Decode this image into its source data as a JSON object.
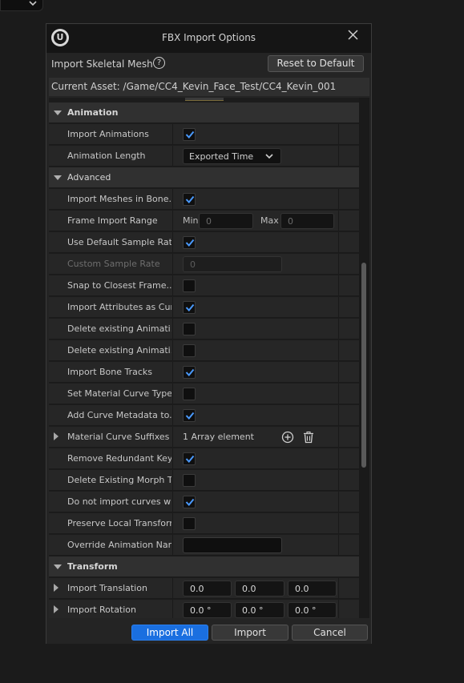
{
  "dialog": {
    "title": "FBX Import Options",
    "close_symbol": "✕",
    "header_label": "Import Skeletal Mesh",
    "help_symbol": "?",
    "reset_label": "Reset to Default",
    "current_asset": "Current Asset:  /Game/CC4_Kevin_Face_Test/CC4_Kevin_001",
    "logo_letter": "U"
  },
  "sections": {
    "animation": "Animation",
    "advanced": "Advanced",
    "transform": "Transform"
  },
  "rows": {
    "import_animations": {
      "label": "Import Animations",
      "checked": true
    },
    "animation_length": {
      "label": "Animation Length",
      "value": "Exported Time"
    },
    "import_meshes_in_bone": {
      "label": "Import Meshes in Bone...",
      "checked": true
    },
    "frame_import_range": {
      "label": "Frame Import Range",
      "min_label": "Min",
      "min_value": "0",
      "max_label": "Max",
      "max_value": "0"
    },
    "use_default_sample_rate": {
      "label": "Use Default Sample Rate",
      "checked": true
    },
    "custom_sample_rate": {
      "label": "Custom Sample Rate",
      "value": "0"
    },
    "snap_to_closest_frame": {
      "label": "Snap to Closest Frame...",
      "checked": false
    },
    "import_attributes_as_curves": {
      "label": "Import Attributes as Cur...",
      "checked": true
    },
    "delete_existing_anim_1": {
      "label": "Delete existing Animati...",
      "checked": false
    },
    "delete_existing_anim_2": {
      "label": "Delete existing Animati...",
      "checked": false
    },
    "import_bone_tracks": {
      "label": "Import Bone Tracks",
      "checked": true
    },
    "set_material_curve_type": {
      "label": "Set Material Curve Type",
      "checked": false
    },
    "add_curve_metadata": {
      "label": "Add Curve Metadata to...",
      "checked": true
    },
    "material_curve_suffixes": {
      "label": "Material Curve Suffixes",
      "value": "1 Array element"
    },
    "remove_redundant_keys": {
      "label": "Remove Redundant Keys",
      "checked": true
    },
    "delete_existing_morph": {
      "label": "Delete Existing Morph T...",
      "checked": false
    },
    "do_not_import_curves": {
      "label": "Do not import curves wi...",
      "checked": true
    },
    "preserve_local_transform": {
      "label": "Preserve Local Transform",
      "checked": false
    },
    "override_animation_name": {
      "label": "Override Animation Name",
      "value": ""
    },
    "import_translation": {
      "label": "Import Translation",
      "x": "0.0",
      "y": "0.0",
      "z": "0.0"
    },
    "import_rotation": {
      "label": "Import Rotation",
      "x": "0.0 °",
      "y": "0.0 °",
      "z": "0.0 °"
    }
  },
  "footer": {
    "import_all": "Import All",
    "import": "Import",
    "cancel": "Cancel"
  },
  "colors": {
    "accent": "#1a6fe0",
    "check": "#4a9aff",
    "background": "#1b1b1b"
  }
}
